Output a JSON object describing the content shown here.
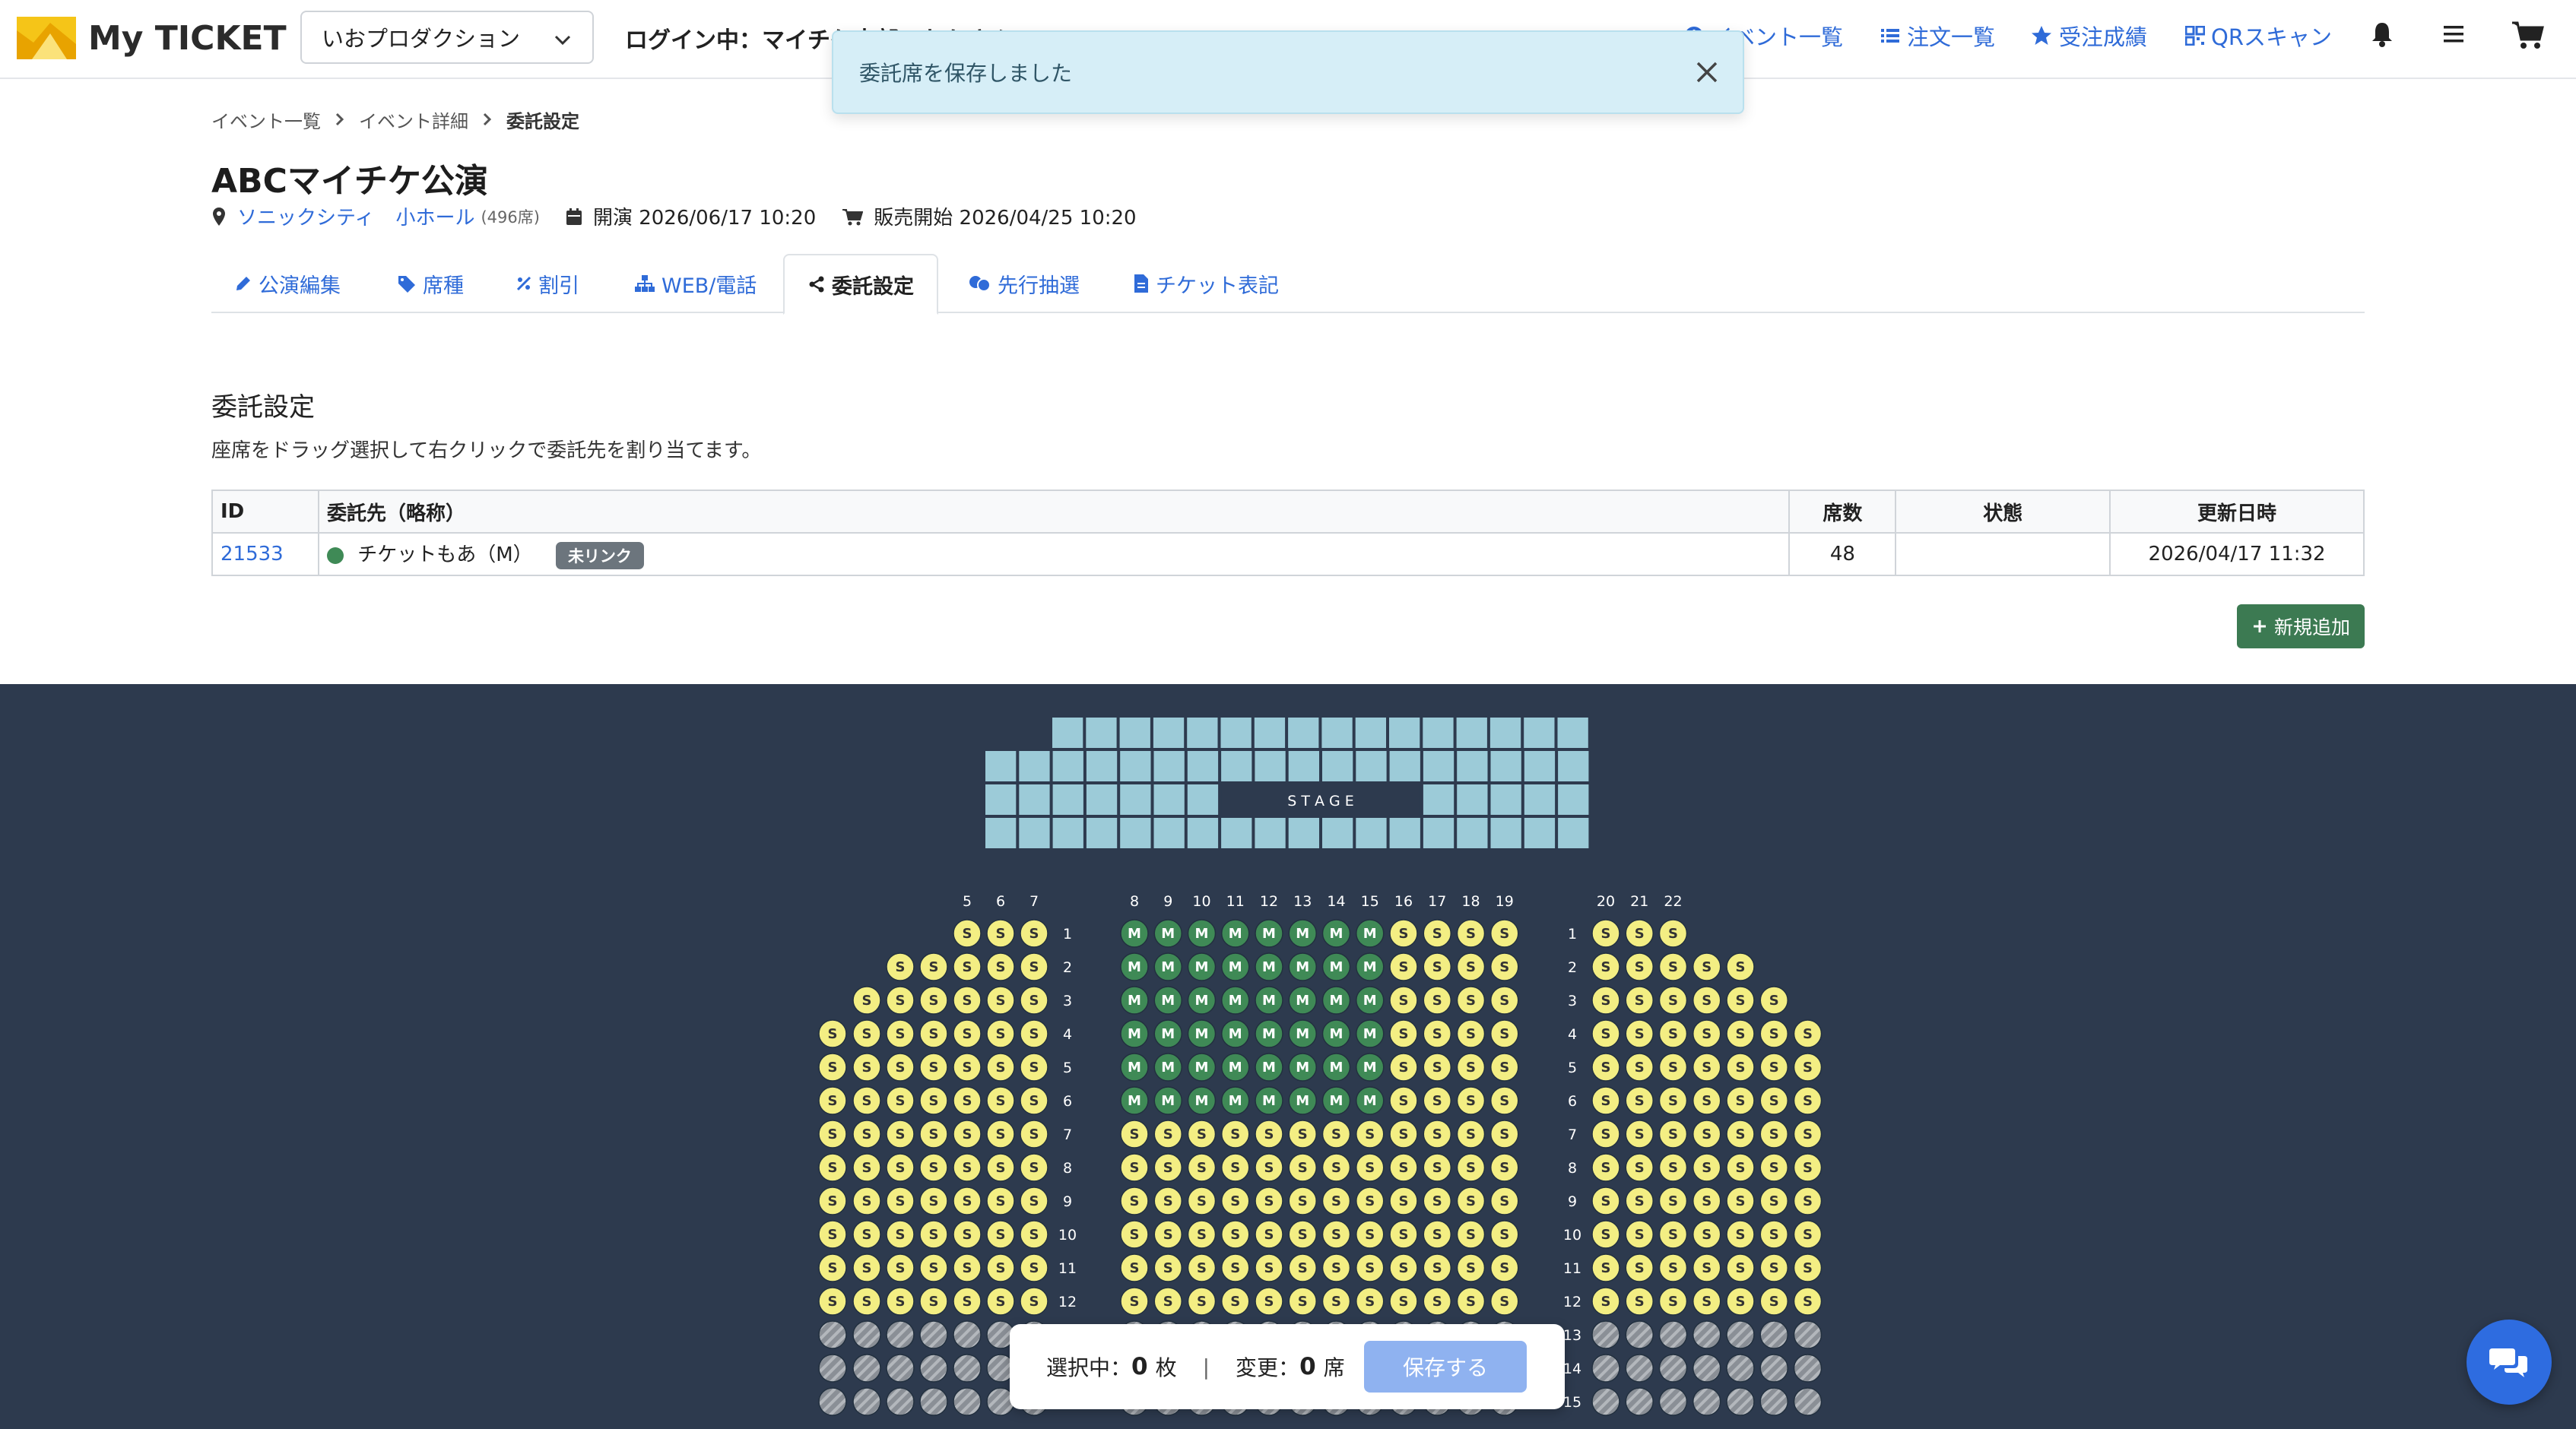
{
  "app": {
    "brand": "My TICKET",
    "accent": "#2f6bd8"
  },
  "header": {
    "org_select": "いおプロダクション",
    "login": "ログイン中：マイチケ本部いおかさん",
    "nav": [
      {
        "label": "イベント一覧",
        "icon": "info-icon"
      },
      {
        "label": "注文一覧",
        "icon": "list-icon"
      },
      {
        "label": "受注成績",
        "icon": "star-icon"
      },
      {
        "label": "QRスキャン",
        "icon": "qr-icon"
      }
    ]
  },
  "toast": {
    "message": "委託席を保存しました"
  },
  "breadcrumb": [
    "イベント一覧",
    "イベント詳細",
    "委託設定"
  ],
  "event": {
    "title": "ABCマイチケ公演",
    "venue": "ソニックシティ",
    "hall": "小ホール",
    "seats": "(496席)",
    "start": "開演 2026/06/17 10:20",
    "sale": "販売開始 2026/04/25 10:20"
  },
  "tabs": [
    {
      "label": "公演編集",
      "icon": "pencil-icon"
    },
    {
      "label": "席種",
      "icon": "tag-icon"
    },
    {
      "label": "割引",
      "icon": "percent-icon"
    },
    {
      "label": "WEB/電話",
      "icon": "sitemap-icon"
    },
    {
      "label": "委託設定",
      "icon": "share-icon"
    },
    {
      "label": "先行抽選",
      "icon": "lottery-icon"
    },
    {
      "label": "チケット表記",
      "icon": "ticket-icon"
    }
  ],
  "section": {
    "title": "委託設定",
    "description": "座席をドラッグ選択して右クリックで委託先を割り当てます。"
  },
  "table": {
    "headers": [
      "ID",
      "委託先（略称）",
      "席数",
      "状態",
      "更新日時"
    ],
    "rows": [
      {
        "id": "21533",
        "name": "チケットもあ（M）",
        "badge": "未リンク",
        "seats": "48",
        "status": "",
        "updated": "2026/04/17 11:32"
      }
    ]
  },
  "add_button": "新規追加",
  "seatmap": {
    "stage_label": "S T A G E",
    "left_columns": [
      "5",
      "6",
      "7"
    ],
    "center_columns": [
      "8",
      "9",
      "10",
      "11",
      "12",
      "13",
      "14",
      "15",
      "16",
      "17",
      "18",
      "19"
    ],
    "right_columns": [
      "20",
      "21",
      "22"
    ],
    "rows": [
      "1",
      "2",
      "3",
      "4",
      "5",
      "6",
      "7",
      "8",
      "9",
      "10",
      "11",
      "12",
      "13",
      "14",
      "15"
    ],
    "seat_s_label": "S",
    "seat_m_label": "M",
    "colors": {
      "s_seat": "#f3ee83",
      "m_seat": "#3f8a56",
      "unavailable": "#8a8f96",
      "stage": "#9ccbd8",
      "background": "#2d3a4e"
    }
  },
  "bottom_bar": {
    "selected_label": "選択中：",
    "selected_count": "0",
    "selected_unit": "枚",
    "divider": "|",
    "changed_label": "変更：",
    "changed_count": "0",
    "changed_unit": "席",
    "save_button": "保存する"
  }
}
